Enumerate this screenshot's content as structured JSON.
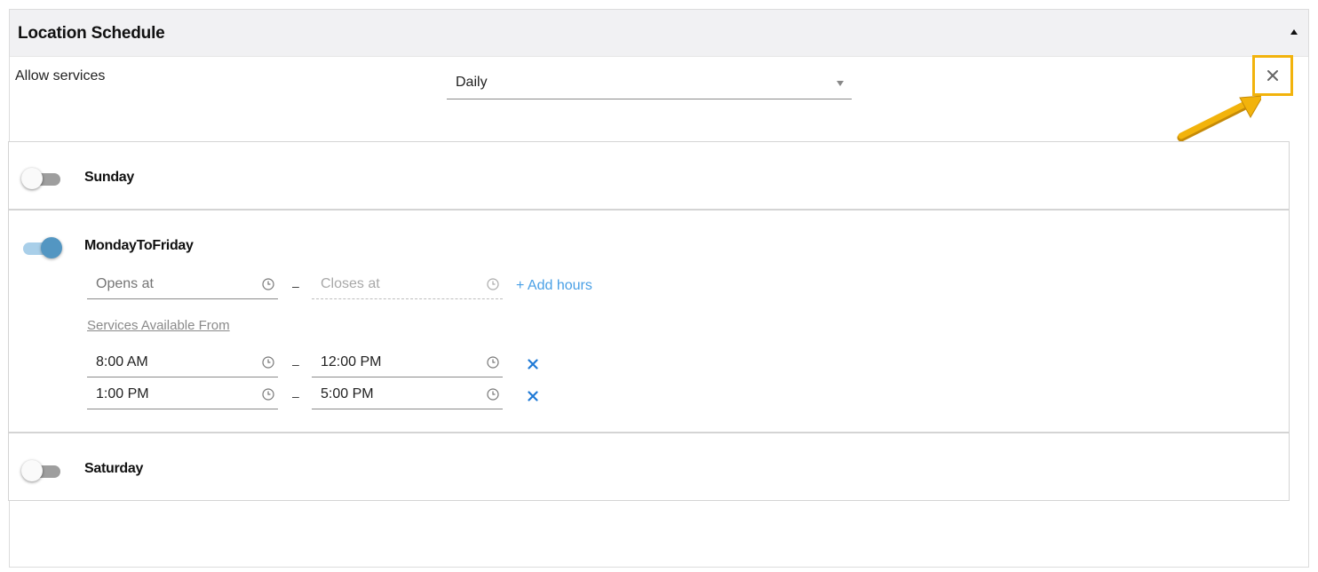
{
  "panel": {
    "title": "Location Schedule",
    "collapse_icon": "caret-up-icon"
  },
  "allow_services": {
    "label": "Allow services",
    "selected": "Daily"
  },
  "close_icon": "close-icon",
  "days": {
    "sunday": {
      "name": "Sunday",
      "enabled": false
    },
    "weekdays": {
      "name": "MondayToFriday",
      "enabled": true,
      "opens_placeholder": "Opens at",
      "closes_placeholder": "Closes at",
      "separator": "–",
      "add_hours": "+ Add hours",
      "services_link": "Services Available From",
      "ranges": [
        {
          "start": "8:00 AM",
          "end": "12:00 PM"
        },
        {
          "start": "1:00 PM",
          "end": "5:00 PM"
        }
      ]
    },
    "saturday": {
      "name": "Saturday",
      "enabled": false
    }
  },
  "colors": {
    "accent_blue": "#4aa0e6",
    "toggle_on": "#5396c2",
    "highlight": "#f2b30c"
  }
}
